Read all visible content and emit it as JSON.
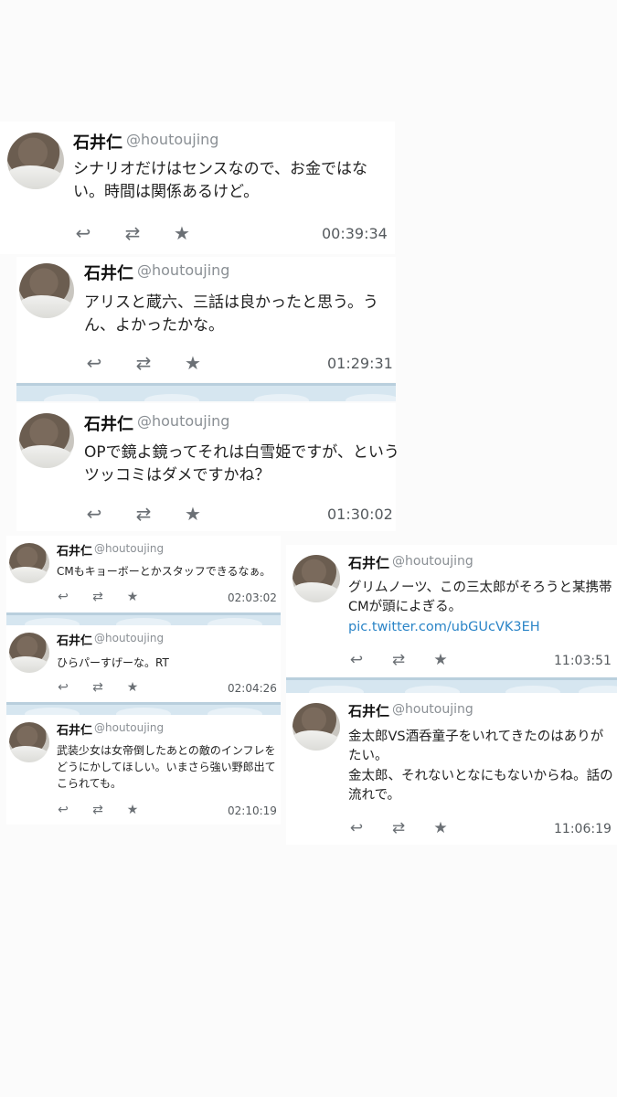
{
  "user": {
    "name": "石井仁",
    "handle": "@houtoujing"
  },
  "tweets": [
    {
      "text": "シナリオだけはセンスなので、お金ではない。時間は関係あるけど。",
      "time": "00:39:34"
    },
    {
      "text": "アリスと蔵六、三話は良かったと思う。うん、よかったかな。",
      "time": "01:29:31"
    },
    {
      "text": "OPで鏡よ鏡ってそれは白雪姫ですが、というツッコミはダメですかね？",
      "time": "01:30:02"
    },
    {
      "text": "CMもキョーボーとかスタッフできるなぁ。",
      "time": "02:03:02"
    },
    {
      "text": "ひらパーすげーな。RT",
      "time": "02:04:26"
    },
    {
      "text": "武装少女は女帝倒したあとの敵のインフレをどうにかしてほしい。いまさら強い野郎出てこられても。",
      "time": "02:10:19"
    },
    {
      "text": "グリムノーツ、この三太郎がそろうと某携帯CMが頭によぎる。",
      "link": "pic.twitter.com/ubGUcVK3EH",
      "time": "11:03:51"
    },
    {
      "text": "金太郎VS酒呑童子をいれてきたのはありがたい。",
      "text2": "金太郎、それないとなにもないからね。話の流れで。",
      "time": "11:06:19"
    }
  ],
  "icons": {
    "reply": "reply-icon",
    "retweet": "retweet-icon",
    "favorite": "star-icon"
  },
  "colors": {
    "link": "#2a84c7",
    "handle": "#8a8f94",
    "separator": "#d6e6f0"
  }
}
